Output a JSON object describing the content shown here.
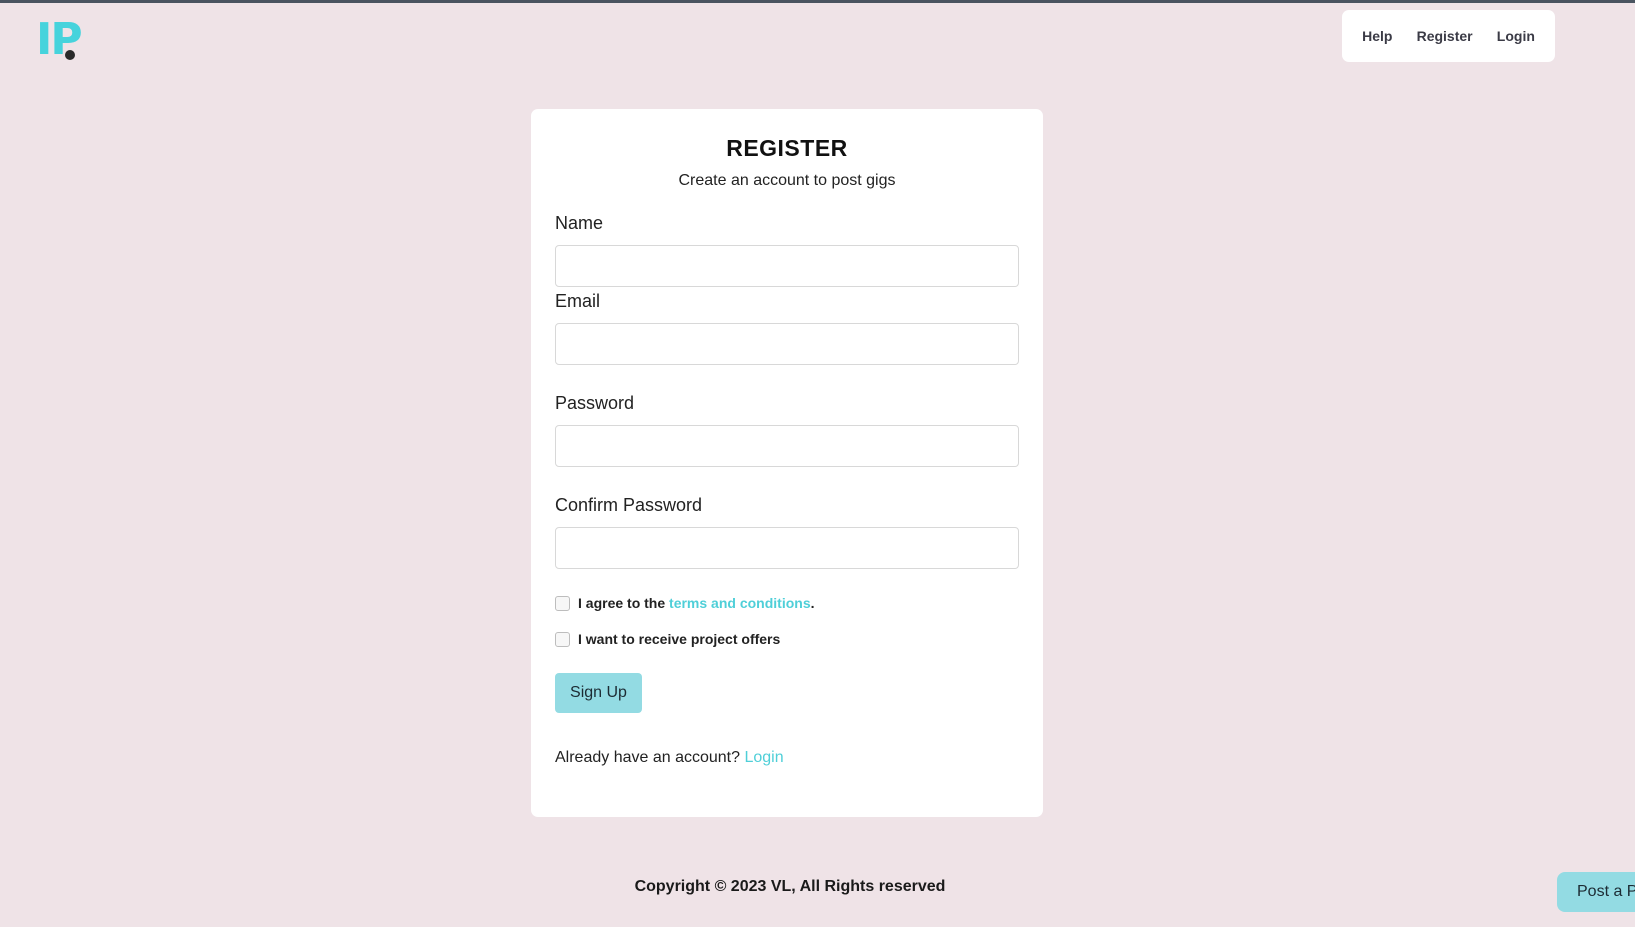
{
  "logo": {
    "text": "IP"
  },
  "nav": {
    "help": "Help",
    "register": "Register",
    "login": "Login"
  },
  "form": {
    "title": "REGISTER",
    "subtitle": "Create an account to post gigs",
    "name_label": "Name",
    "email_label": "Email",
    "password_label": "Password",
    "confirm_label": "Confirm Password",
    "name_value": "",
    "email_value": "",
    "password_value": "",
    "confirm_value": "",
    "terms_prefix": "I agree to the ",
    "terms_link": "terms and conditions",
    "terms_suffix": ".",
    "offers_label": "I want to receive project offers",
    "signup_label": "Sign Up",
    "already_text": "Already have an account? ",
    "login_link": "Login"
  },
  "footer": {
    "copyright": "Copyright © 2023 VL, All Rights reserved"
  },
  "floating": {
    "post_label": "Post a Pr"
  },
  "colors": {
    "accent": "#46d3dc",
    "button": "#93dbe3",
    "background": "#efe3e7"
  }
}
